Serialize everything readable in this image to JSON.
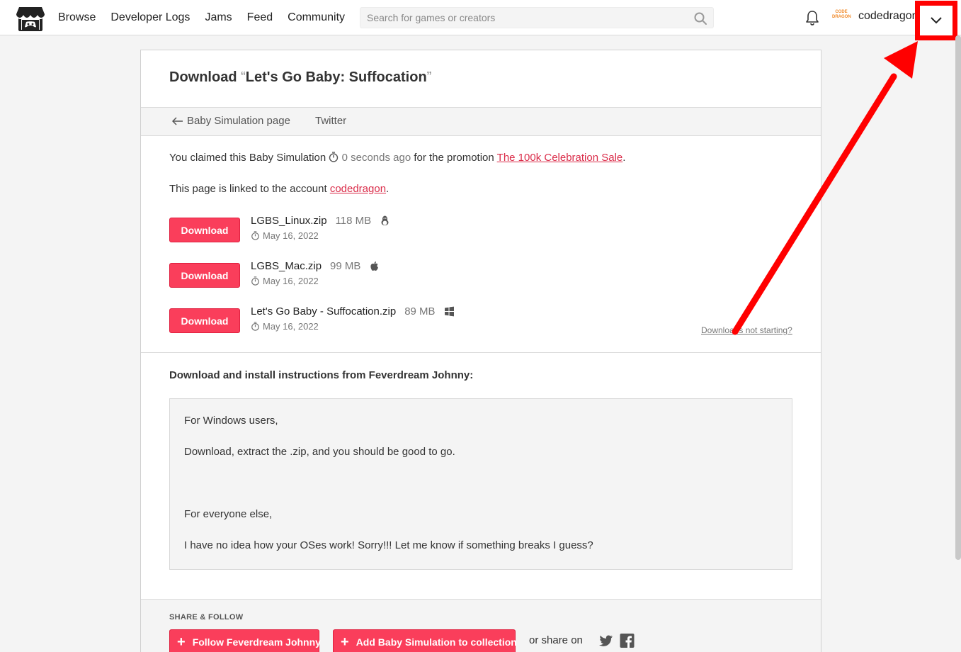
{
  "header": {
    "nav": [
      "Browse",
      "Developer Logs",
      "Jams",
      "Feed",
      "Community"
    ],
    "search_placeholder": "Search for games or creators",
    "avatar_text": "CODE DRAGON",
    "username": "codedragon"
  },
  "page": {
    "title_prefix": "Download",
    "open_quote": "“",
    "game_title": "Let's Go Baby: Suffocation",
    "close_quote": "”",
    "back_link": "Baby Simulation page",
    "twitter_link": "Twitter",
    "claim": {
      "prefix": "You claimed this Baby Simulation",
      "time": "0 seconds ago",
      "middle": "for the promotion",
      "promotion": "The 100k Celebration Sale",
      "suffix": "."
    },
    "account": {
      "prefix": "This page is linked to the account",
      "name": "codedragon",
      "suffix": "."
    },
    "download_label": "Download",
    "downloads": [
      {
        "name": "LGBS_Linux.zip",
        "size": "118 MB",
        "os_icon": "linux-icon",
        "date": "May 16, 2022"
      },
      {
        "name": "LGBS_Mac.zip",
        "size": "99 MB",
        "os_icon": "apple-icon",
        "date": "May 16, 2022"
      },
      {
        "name": "Let's Go Baby - Suffocation.zip",
        "size": "89 MB",
        "os_icon": "windows-icon",
        "date": "May 16, 2022"
      }
    ],
    "not_starting": "Downloads not starting?",
    "instructions_title": "Download and install instructions from Feverdream Johnny:",
    "instructions": [
      "For Windows users,",
      "Download, extract the .zip, and you should be good to go.",
      "For everyone else,",
      "I have no idea how your OSes work! Sorry!!! Let me know if something breaks I guess?"
    ],
    "share": {
      "title": "SHARE & FOLLOW",
      "follow_button": "Follow Feverdream Johnny",
      "collection_button": "Add Baby Simulation to collection",
      "or_share": "or share on"
    }
  },
  "colors": {
    "accent": "#fa3e5b",
    "link": "#da2c49",
    "annotation": "#ff0000"
  }
}
